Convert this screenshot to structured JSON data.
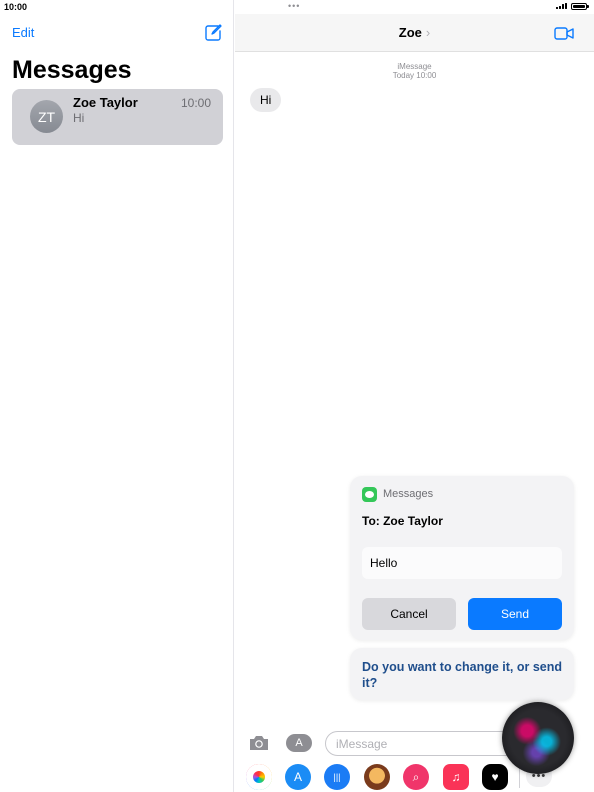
{
  "status_bar": {
    "time": "10:00",
    "dots": "•••"
  },
  "sidebar": {
    "edit_label": "Edit",
    "title": "Messages",
    "conversations": [
      {
        "initials": "ZT",
        "name": "Zoe Taylor",
        "time": "10:00",
        "preview": "Hi"
      }
    ]
  },
  "conversation": {
    "contact_name": "Zoe",
    "chevron": "›",
    "service": "iMessage",
    "timestamp": "Today 10:00",
    "messages": [
      {
        "text": "Hi",
        "direction": "incoming"
      }
    ]
  },
  "siri": {
    "app_name": "Messages",
    "to_line": "To: Zoe Taylor",
    "message_text": "Hello",
    "cancel_label": "Cancel",
    "send_label": "Send",
    "question": "Do you want to change it, or send it?"
  },
  "input": {
    "placeholder": "iMessage"
  },
  "app_strip": {
    "icons": [
      "photos-icon",
      "app-store-icon",
      "audio-message-icon",
      "memoji-icon",
      "search-images-icon",
      "music-icon",
      "digital-touch-icon",
      "more-icon"
    ],
    "more_label": "•••"
  },
  "colors": {
    "accent": "#0a7aff",
    "selected_row": "#d1d1d6",
    "bubble": "#e9e9eb",
    "siri_question": "#1f4e8c"
  }
}
